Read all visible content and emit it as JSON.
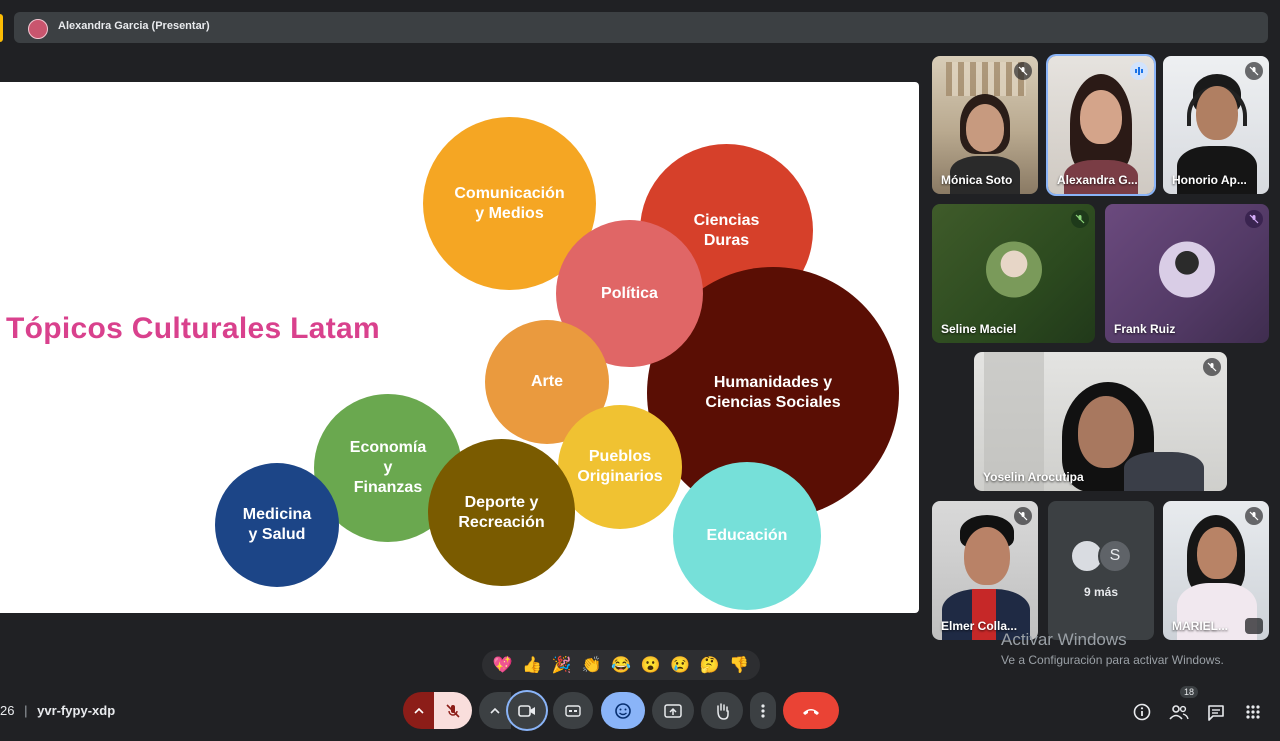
{
  "presenter_bar": {
    "label": "Alexandra Garcia (Presentar)"
  },
  "slide": {
    "title": "Tópicos Culturales Latam",
    "bubbles": [
      {
        "label": "Comunicación\ny Medios",
        "color": "#f5a623"
      },
      {
        "label": "Ciencias\nDuras",
        "color": "#d6402a"
      },
      {
        "label": "Política",
        "color": "#e06666"
      },
      {
        "label": "Humanidades y\nCiencias Sociales",
        "color": "#5a0e04"
      },
      {
        "label": "Arte",
        "color": "#ea9a3e"
      },
      {
        "label": "Economía\ny\nFinanzas",
        "color": "#6aa84f"
      },
      {
        "label": "Pueblos\nOriginarios",
        "color": "#f0c232"
      },
      {
        "label": "Deporte y\nRecreación",
        "color": "#7a5b00"
      },
      {
        "label": "Medicina\ny Salud",
        "color": "#1c4587"
      },
      {
        "label": "Educación",
        "color": "#76e0d9"
      }
    ]
  },
  "participants": [
    {
      "name": "Mónica Soto",
      "muted": true
    },
    {
      "name": "Alexandra G...",
      "speaking": true
    },
    {
      "name": "Honorio Ap...",
      "muted": true
    },
    {
      "name": "Seline Maciel",
      "muted": true
    },
    {
      "name": "Frank Ruiz",
      "muted": true
    },
    {
      "name": "Yoselin Arocutipa",
      "muted": true
    },
    {
      "name": "Elmer Colla...",
      "muted": true
    },
    {
      "name": "9 más",
      "initial": "S"
    },
    {
      "name": "MARIEL...",
      "muted": true
    }
  ],
  "watermark": {
    "title": "Activar Windows",
    "subtitle": "Ve a Configuración para activar Windows."
  },
  "reactions": [
    "💖",
    "👍",
    "🎉",
    "👏",
    "😂",
    "😮",
    "😢",
    "🤔",
    "👎"
  ],
  "meeting": {
    "time_fragment": "26",
    "separator": "|",
    "code": "yvr-fypy-xdp"
  },
  "people_count": "18",
  "colors": {
    "accent": "#8ab4f8",
    "end_call": "#ea4335",
    "mic_off": "#f9dedc"
  }
}
